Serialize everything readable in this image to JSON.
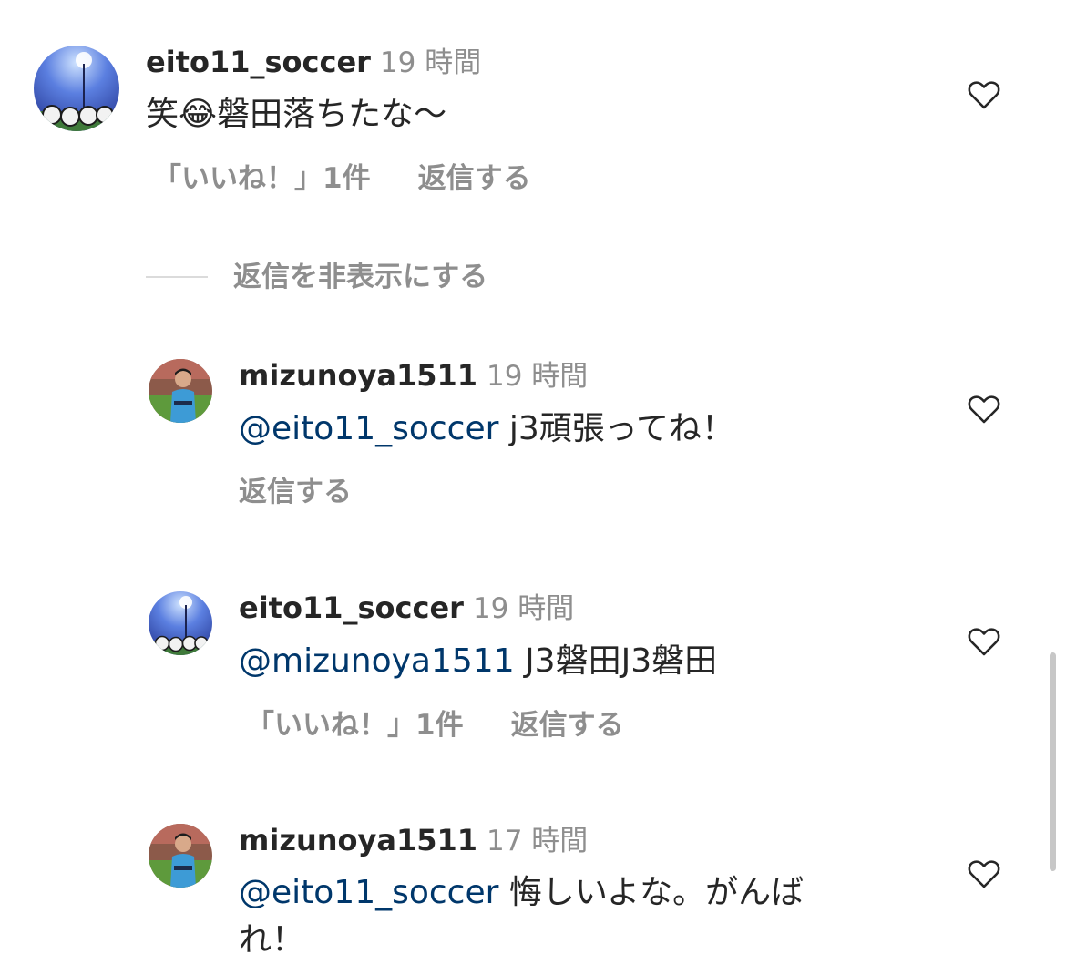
{
  "comments": [
    {
      "username": "eito11_soccer",
      "time": "19 時間",
      "text_before_emoji": "笑",
      "emoji": "😂",
      "text_after_emoji": "磐田落ちたな〜",
      "likes": "「いいね！」1件",
      "reply": "返信する"
    },
    {
      "username": "mizunoya1511",
      "time": "19 時間",
      "mention": "@eito11_soccer",
      "text": " j3頑張ってね！",
      "reply": "返信する"
    },
    {
      "username": "eito11_soccer",
      "time": "19 時間",
      "mention": "@mizunoya1511",
      "text": " J3磐田J3磐田",
      "likes": "「いいね！」1件",
      "reply": "返信する"
    },
    {
      "username": "mizunoya1511",
      "time": "17 時間",
      "mention": "@eito11_soccer",
      "text": " 悔しいよな。がんば",
      "text_line2": "れ！"
    }
  ],
  "hide_replies": "返信を非表示にする",
  "icons": {
    "like": "heart-outline-icon",
    "avatar_eito": "stadium-lights-soccer-balls",
    "avatar_mizunoya": "soccer-player-photo"
  },
  "colors": {
    "text": "#262626",
    "secondary": "#8e8e8e",
    "mention": "#00376b",
    "divider": "#dbdbdb"
  }
}
